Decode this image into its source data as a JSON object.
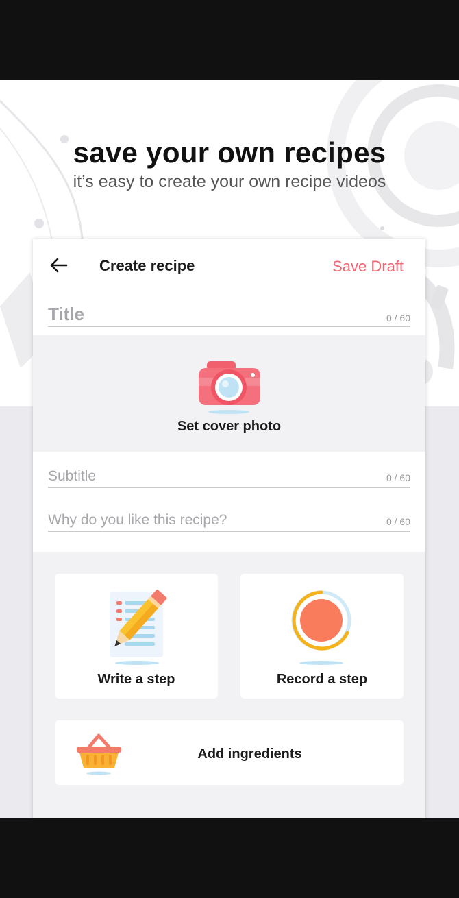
{
  "hero": {
    "headline": "save your own recipes",
    "subline": "it’s easy to create your own recipe videos"
  },
  "appbar": {
    "back_icon": "arrow-left-icon",
    "title": "Create recipe",
    "save_draft": "Save Draft"
  },
  "form": {
    "title": {
      "placeholder": "Title",
      "value": "",
      "counter": "0 / 60"
    },
    "cover": {
      "icon": "camera-icon",
      "label": "Set cover photo"
    },
    "subtitle": {
      "placeholder": "Subtitle",
      "value": "",
      "counter": "0 / 60"
    },
    "why": {
      "placeholder": "Why do you like this recipe?",
      "value": "",
      "counter": "0 / 60"
    }
  },
  "actions": {
    "write_step": {
      "icon": "pencil-note-icon",
      "label": "Write a step"
    },
    "record_step": {
      "icon": "record-icon",
      "label": "Record a step"
    },
    "add_ingredients": {
      "icon": "basket-icon",
      "label": "Add ingredients"
    }
  },
  "colors": {
    "accent": "#f06471",
    "camera": "#f4707c",
    "record": "#f97c5c",
    "basket": "#f9b233"
  }
}
